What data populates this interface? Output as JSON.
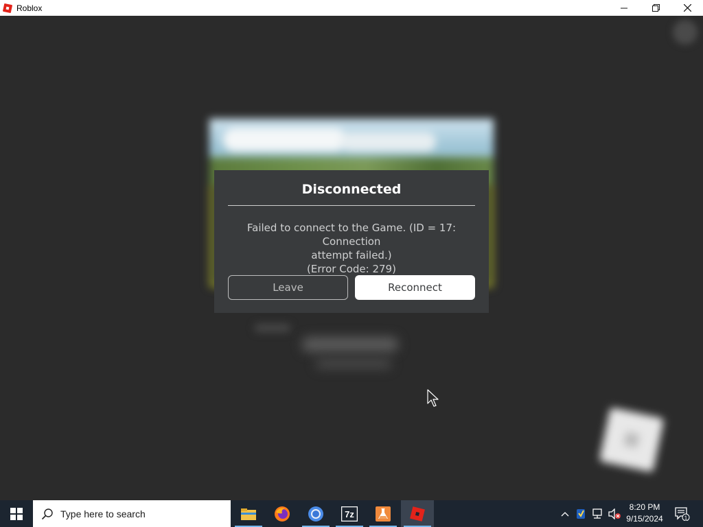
{
  "window": {
    "title": "Roblox",
    "minimize_glyph": "—",
    "restore_glyph": "❐",
    "close_glyph": "✕"
  },
  "dialog": {
    "title": "Disconnected",
    "message_line1": "Failed to connect to the Game. (ID = 17: Connection",
    "message_line2": "attempt failed.)",
    "message_line3": "(Error Code: 279)",
    "leave_label": "Leave",
    "reconnect_label": "Reconnect"
  },
  "taskbar": {
    "search_placeholder": "Type here to search",
    "apps": [
      {
        "name": "file-explorer-icon"
      },
      {
        "name": "firefox-icon"
      },
      {
        "name": "chrome-icon"
      },
      {
        "name": "7zip-icon"
      },
      {
        "name": "lab-flask-icon"
      },
      {
        "name": "roblox-icon"
      }
    ],
    "seven_zip_label": "7z",
    "clock_time": "8:20 PM",
    "clock_date": "9/15/2024",
    "notification_count": "1"
  },
  "colors": {
    "dialog_bg": "#393b3d",
    "taskbar_bg": "#1c2530",
    "roblox_red": "#e2231a",
    "accent_underline": "#76b9ed"
  }
}
